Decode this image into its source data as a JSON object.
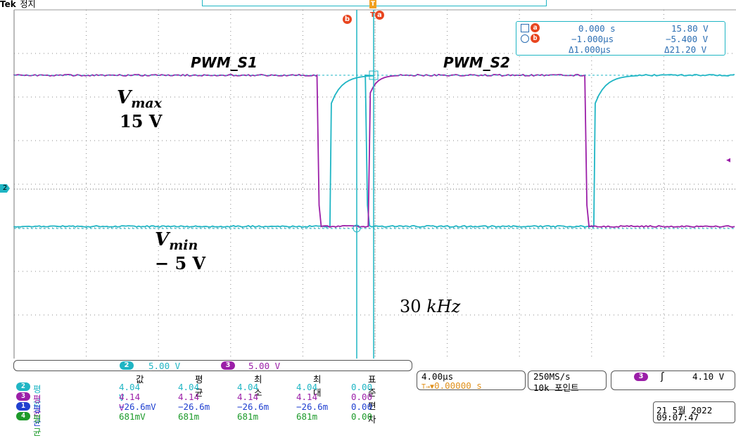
{
  "header": {
    "brand": "Tek",
    "status": "정지"
  },
  "markers": {
    "trigger_top": "T",
    "cursor_a": "a",
    "cursor_b": "b",
    "channel2_ref": "2"
  },
  "cursor_readout": {
    "a_time": "0.000 s",
    "a_value": "15.80 V",
    "b_time": "−1.000μs",
    "b_value": "−5.400 V",
    "delta_time": "Δ1.000μs",
    "delta_value": "Δ21.20 V"
  },
  "annotations": {
    "pwm_s1": "PWM_S1",
    "pwm_s2": "PWM_S2",
    "vmax_v": "V",
    "vmax_sub": "max",
    "vmax_val": "15 V",
    "vmin_v": "V",
    "vmin_sub": "min",
    "vmin_val": "− 5 V",
    "freq_num": "30",
    "freq_unit": "kHz"
  },
  "channel_bar": {
    "ch2_num": "2",
    "ch2_scale": "5.00 V",
    "ch3_num": "3",
    "ch3_scale": "5.00 V"
  },
  "measurements": {
    "headers": [
      "값",
      "평균",
      "최소",
      "최대",
      "표준편차"
    ],
    "rows": [
      {
        "ch": "2",
        "label": "평균",
        "value": "4.04 V",
        "mean": "4.04",
        "min": "4.04",
        "max": "4.04",
        "std": "0.00",
        "color": "#1fb5c4"
      },
      {
        "ch": "3",
        "label": "평균",
        "value": "4.14 V",
        "mean": "4.14",
        "min": "4.14",
        "max": "4.14",
        "std": "0.00",
        "color": "#9b1fa8"
      },
      {
        "ch": "1",
        "label": "평균",
        "value": "−26.6mV",
        "mean": "−26.6m",
        "min": "−26.6m",
        "max": "−26.6m",
        "std": "0.00",
        "color": "#2040d0"
      },
      {
        "ch": "4",
        "label": "평균",
        "value": "681mV",
        "mean": "681m",
        "min": "681m",
        "max": "681m",
        "std": "0.00",
        "color": "#1c9a2a"
      }
    ]
  },
  "timebase": {
    "scale": "4.00μs",
    "position": "0.00000 s",
    "position_prefix": "T→▼"
  },
  "acquisition": {
    "rate": "250MS/s",
    "points": "10k 포인트"
  },
  "trigger": {
    "ch": "3",
    "slope": "ʃ",
    "level": "4.10 V"
  },
  "datetime": {
    "date": "21 5월 2022",
    "time": "09:07:47"
  },
  "colors": {
    "ch2": "#1fb5c4",
    "ch3": "#9b1fa8",
    "ch1": "#2040d0",
    "ch4": "#1c9a2a",
    "cursor": "#1fb5c4",
    "marker": "#e8451f"
  },
  "waveforms": {
    "volts_per_div": 5,
    "ch3_edges": [
      {
        "t": -3.14,
        "dir": "fall"
      },
      {
        "t": -0.3,
        "dir": "rise"
      },
      {
        "t": 11.7,
        "dir": "fall"
      }
    ],
    "ch2_edges": [
      {
        "t": -2.42,
        "dir": "rise"
      },
      {
        "t": -0.46,
        "dir": "fall"
      },
      {
        "t": 12.2,
        "dir": "rise"
      }
    ],
    "high_div": 3.0,
    "low_div": -1.0
  }
}
